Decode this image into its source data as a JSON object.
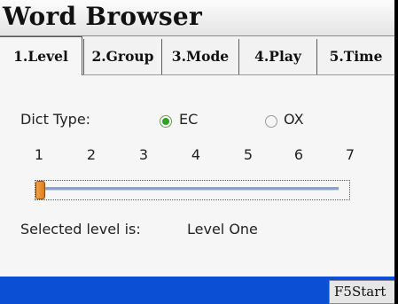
{
  "app": {
    "title": "Word Browser"
  },
  "tabs": [
    {
      "label": "1.Level",
      "active": true
    },
    {
      "label": "2.Group",
      "active": false
    },
    {
      "label": "3.Mode",
      "active": false
    },
    {
      "label": "4.Play",
      "active": false
    },
    {
      "label": "5.Time",
      "active": false
    }
  ],
  "level_panel": {
    "dict_type_label": "Dict Type:",
    "options": [
      {
        "label": "EC",
        "selected": true
      },
      {
        "label": "OX",
        "selected": false
      }
    ],
    "slider": {
      "ticks": [
        "1",
        "2",
        "3",
        "4",
        "5",
        "6",
        "7"
      ],
      "value": 1,
      "min": 1,
      "max": 7
    },
    "selected_text": "Selected level is:",
    "selected_value": "Level One"
  },
  "status_bar": {
    "softkey_label": "F5Start"
  },
  "colors": {
    "status_bar": "#0a4fd4",
    "radio_selected": "#2fa02a",
    "slider_thumb": "#e07b1c",
    "slider_rail": "#8a9ed8"
  }
}
